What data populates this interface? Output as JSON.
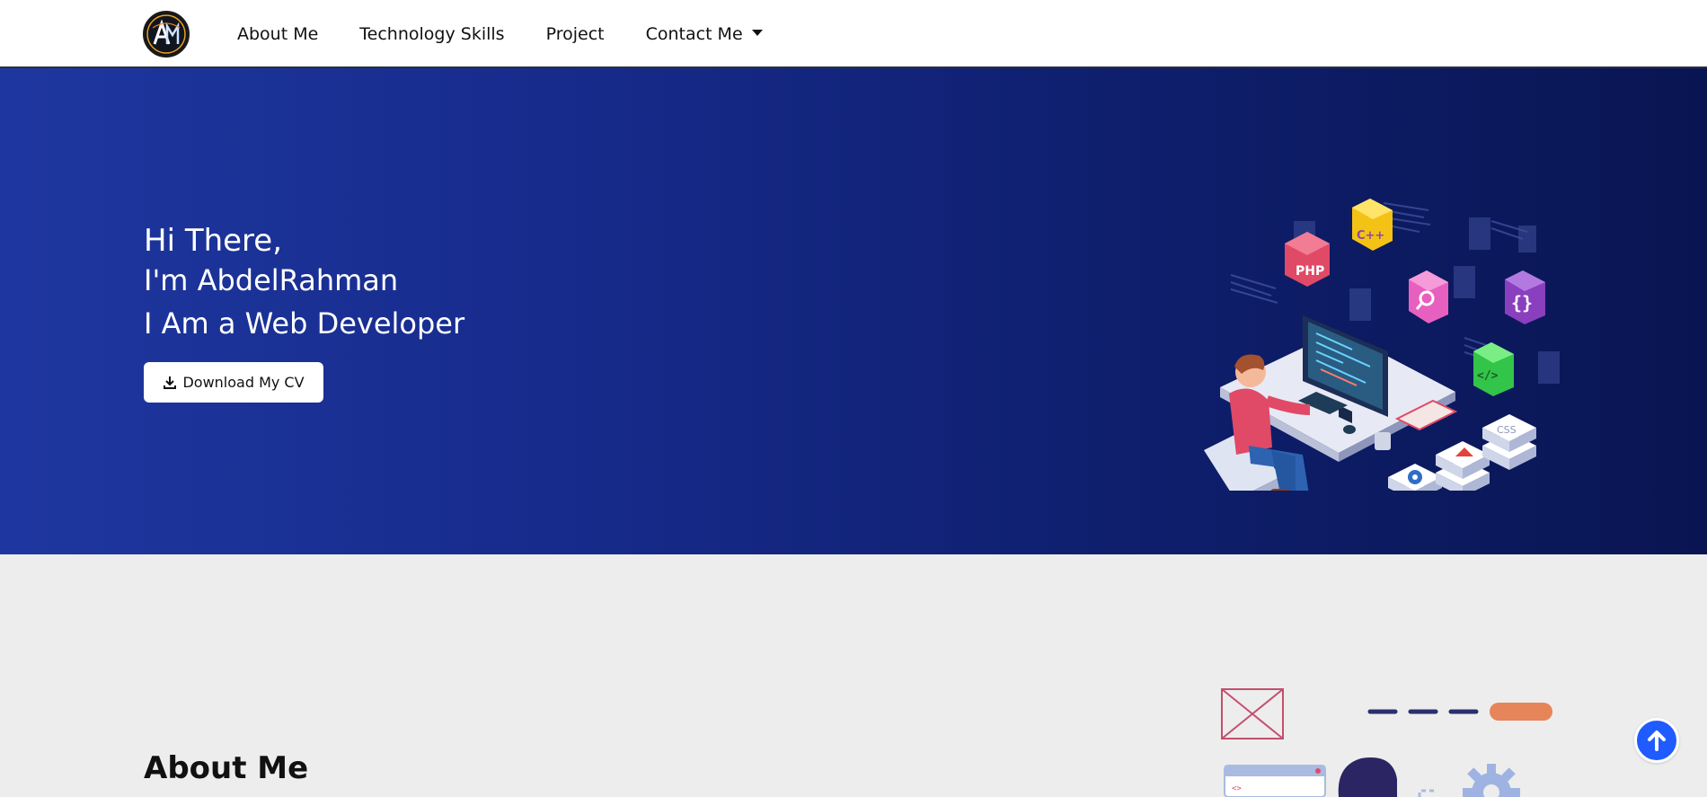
{
  "nav": {
    "items": [
      {
        "label": "About Me"
      },
      {
        "label": "Technology Skills"
      },
      {
        "label": "Project"
      },
      {
        "label": "Contact Me"
      }
    ]
  },
  "hero": {
    "greeting": "Hi There,",
    "name_line": "I'm AbdelRahman",
    "role_line": "I Am a Web Developer",
    "cv_button": "Download My CV"
  },
  "illustration": {
    "php_label": "PHP",
    "cpp_label": "C++",
    "css_label": "CSS"
  },
  "about": {
    "title": "About Me"
  },
  "colors": {
    "hero_start": "#1e37a0",
    "hero_end": "#091552",
    "accent": "#1f5bff"
  },
  "icons": {
    "download": "download-icon",
    "caret": "caret-down-icon",
    "top": "arrow-up-icon"
  }
}
